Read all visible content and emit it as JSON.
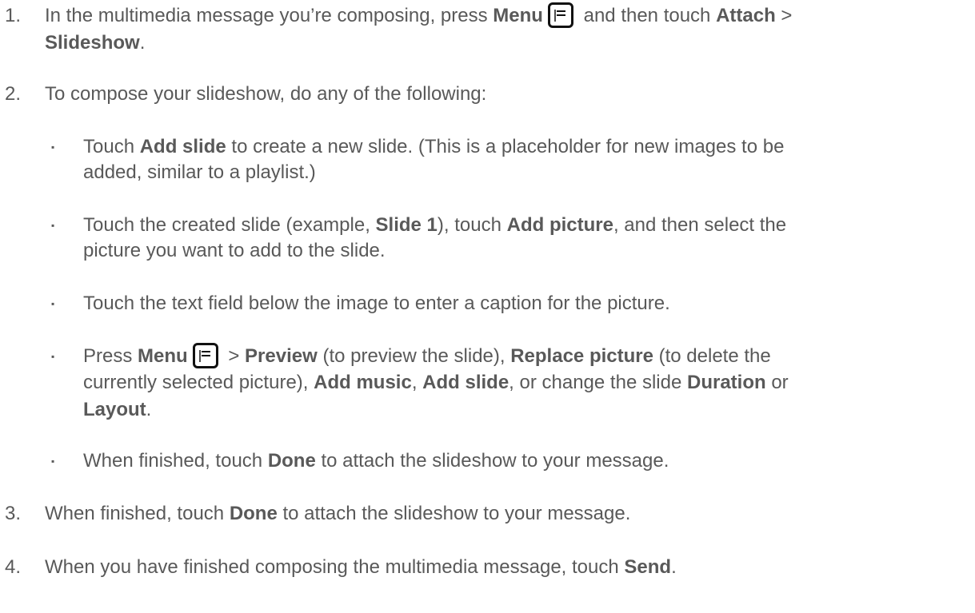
{
  "steps": [
    {
      "num": "1.",
      "l1_a": "In the multimedia message you’re composing, press ",
      "l1_b": "Menu",
      "l1_c": " and then touch ",
      "l1_d": "Attach",
      "l1_e": " >",
      "l2_a": "Slideshow",
      "l2_b": "."
    },
    {
      "num": "2.",
      "text": "To compose your slideshow, do any of the following:"
    },
    {
      "num": "3.",
      "a": "When finished, touch ",
      "b": "Done",
      "c": " to attach the slideshow to your message."
    },
    {
      "num": "4.",
      "a": "When you have finished composing the multimedia message, touch ",
      "b": "Send",
      "c": "."
    }
  ],
  "bullets": [
    {
      "l1_a": "Touch ",
      "l1_b": "Add slide",
      "l1_c": " to create a new slide. (This is a placeholder for new images to be",
      "l2": "added, similar to a playlist.)"
    },
    {
      "l1_a": "Touch the created slide (example, ",
      "l1_b": "Slide 1",
      "l1_c": "), touch ",
      "l1_d": "Add picture",
      "l1_e": ", and then select the",
      "l2": "picture you want to add to the slide."
    },
    {
      "text": "Touch the text field below the image to enter a caption for the picture."
    },
    {
      "l1_a": "Press ",
      "l1_b": "Menu",
      "l1_c": " > ",
      "l1_d": "Preview",
      "l1_e": " (to preview the slide), ",
      "l1_f": "Replace picture",
      "l1_g": " (to delete the",
      "l2_a": "currently selected picture), ",
      "l2_b": "Add music",
      "l2_c": ", ",
      "l2_d": "Add slide",
      "l2_e": ", or change the slide ",
      "l2_f": "Duration",
      "l2_g": " or",
      "l3_a": "Layout",
      "l3_b": "."
    },
    {
      "a": "When finished, touch ",
      "b": "Done",
      "c": " to attach the slideshow to your message."
    }
  ],
  "bullet_glyph": "▪",
  "icons": {
    "menu": "menu-key-icon"
  }
}
